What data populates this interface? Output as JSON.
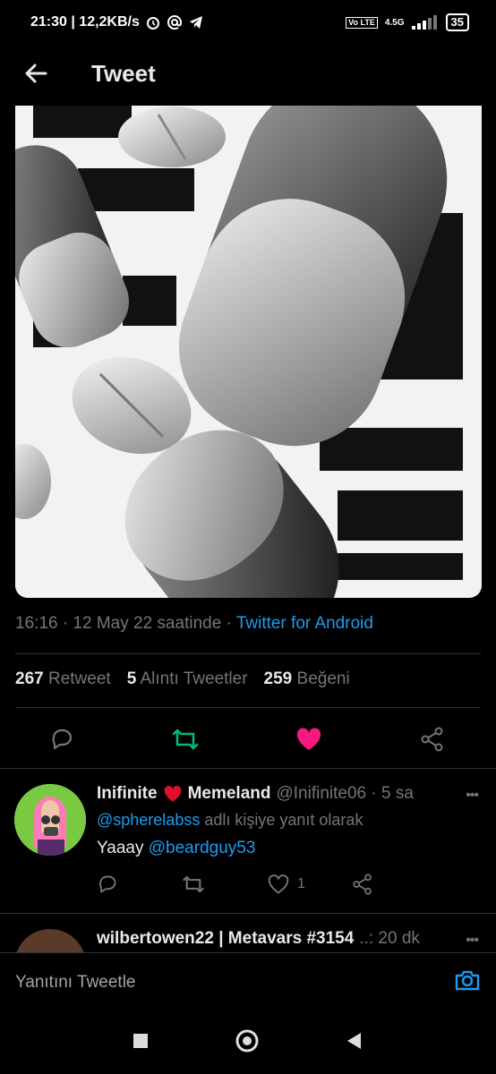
{
  "status_bar": {
    "time_speed": "21:30 | 12,2KB/s",
    "volte": "Vo LTE",
    "network": "4.5G",
    "battery": "35"
  },
  "header": {
    "title": "Tweet"
  },
  "tweet": {
    "timestamp": "16:16 · 12 May 22 saatinde ·",
    "source": "Twitter for Android",
    "stats": {
      "retweet_count": "267",
      "retweet_label": "Retweet",
      "quote_count": "5",
      "quote_label": "Alıntı Tweetler",
      "like_count": "259",
      "like_label": "Beğeni"
    }
  },
  "replies": [
    {
      "name_a": "Inifinite",
      "name_b": "Memeland",
      "handle_time": "@Inifinite06 · 5 sa",
      "reply_prefix": "@spherelabss",
      "reply_suffix": "adlı kişiye yanıt olarak",
      "text": "Yaaay",
      "mention": "@beardguy53",
      "like_count": "1"
    },
    {
      "name": "wilbertowen22 | Metavars #3154",
      "handle_time": "..: 20 dk"
    }
  ],
  "compose": {
    "placeholder": "Yanıtını Tweetle"
  },
  "colors": {
    "accent": "#1d9bf0",
    "like": "#f91880",
    "retweet": "#00ba7c",
    "muted": "#71767b"
  }
}
